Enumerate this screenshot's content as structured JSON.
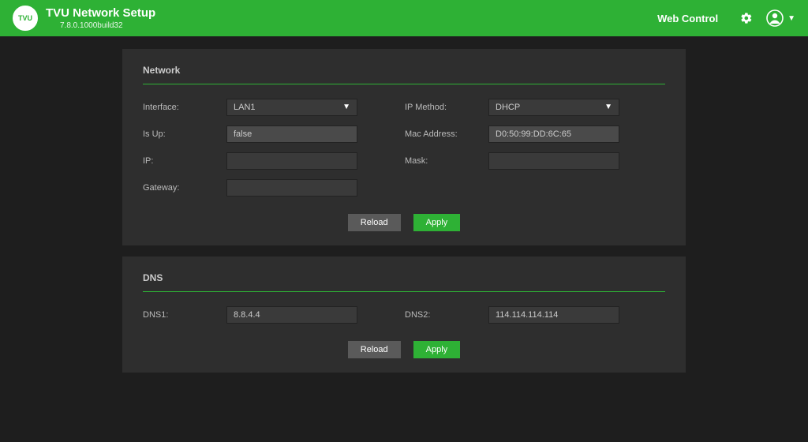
{
  "header": {
    "logo_text": "TVU",
    "title": "TVU Network Setup",
    "version": "7.8.0.1000build32",
    "web_control": "Web Control"
  },
  "network": {
    "section_title": "Network",
    "labels": {
      "interface": "Interface:",
      "ip_method": "IP Method:",
      "is_up": "Is Up:",
      "mac": "Mac Address:",
      "ip": "IP:",
      "mask": "Mask:",
      "gateway": "Gateway:"
    },
    "values": {
      "interface": "LAN1",
      "ip_method": "DHCP",
      "is_up": "false",
      "mac": "D0:50:99:DD:6C:65",
      "ip": "",
      "mask": "",
      "gateway": ""
    },
    "buttons": {
      "reload": "Reload",
      "apply": "Apply"
    }
  },
  "dns": {
    "section_title": "DNS",
    "labels": {
      "dns1": "DNS1:",
      "dns2": "DNS2:"
    },
    "values": {
      "dns1": "8.8.4.4",
      "dns2": "114.114.114.114"
    },
    "buttons": {
      "reload": "Reload",
      "apply": "Apply"
    }
  }
}
